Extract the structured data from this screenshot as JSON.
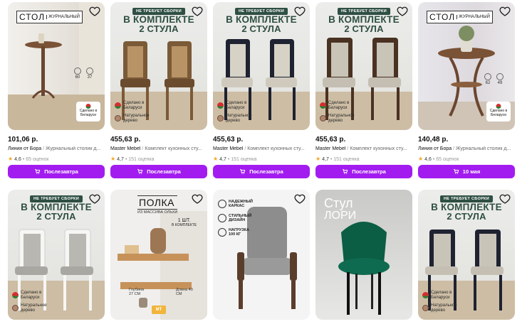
{
  "cards": [
    {
      "thumb_text": {
        "stol_big": "СТОЛ",
        "stol_small": "ЖУРНАЛЬНЫЙ",
        "dim1": "60",
        "dim2": "37",
        "badge": "Сделано в Беларуси"
      },
      "price": "101,06 р.",
      "seller": "Линия от Бора",
      "title": "Журнальный столик д...",
      "rating": "4,6",
      "reviews": "65 оценок",
      "button": "Послезавтра"
    },
    {
      "thumb_text": {
        "top": "НЕ ТРЕБУЕТ СБОРКИ",
        "line1": "В КОМПЛЕКТЕ",
        "line2": "2 СТУЛА",
        "made": "Сделано в Беларуси",
        "wood": "Натуральное дерево"
      },
      "price": "455,63 р.",
      "seller": "Master Mebel",
      "title": "Комплект кухонных сту...",
      "rating": "4,7",
      "reviews": "151 оценка",
      "button": "Послезавтра"
    },
    {
      "thumb_text": {
        "top": "НЕ ТРЕБУЕТ СБОРКИ",
        "line1": "В КОМПЛЕКТЕ",
        "line2": "2 СТУЛА",
        "made": "Сделано в Беларуси",
        "wood": "Натуральное дерево"
      },
      "price": "455,63 р.",
      "seller": "Master Mebel",
      "title": "Комплект кухонных сту...",
      "rating": "4,7",
      "reviews": "151 оценка",
      "button": "Послезавтра"
    },
    {
      "thumb_text": {
        "top": "НЕ ТРЕБУЕТ СБОРКИ",
        "line1": "В КОМПЛЕКТЕ",
        "line2": "2 СТУЛА",
        "made": "Сделано в Беларуси",
        "wood": "Натуральное дерево"
      },
      "price": "455,63 р.",
      "seller": "Master Mebel",
      "title": "Комплект кухонных сту...",
      "rating": "4,7",
      "reviews": "151 оценка",
      "button": "Послезавтра"
    },
    {
      "thumb_text": {
        "stol_big": "СТОЛ",
        "stol_small": "ЖУРНАЛЬНЫЙ",
        "dim1": "62",
        "dim2": "49",
        "badge": "Сделано в Беларуси"
      },
      "price": "140,48 р.",
      "seller": "Линия от Бора",
      "title": "Журнальный столик д...",
      "rating": "4,6",
      "reviews": "65 оценок",
      "button": "10 мая"
    }
  ],
  "row2": [
    {
      "top": "НЕ ТРЕБУЕТ СБОРКИ",
      "line1": "В КОМПЛЕКТЕ",
      "line2": "2 СТУЛА",
      "made": "Сделано в Беларуси",
      "wood": "Натуральное дерево"
    },
    {
      "big": "ПОЛКА",
      "small": "ИЗ МАССИВА ОЛЬХИ",
      "qty": "1 ШТ.",
      "qty_sub": "В КОМПЛЕКТЕ",
      "depth": "Глубина 27 СМ",
      "length": "Длина 40 СМ",
      "brand": "МТ"
    },
    {
      "f1": "НАДЕЖНЫЙ КАРКАС",
      "f2": "СТИЛЬНЫЙ ДИЗАЙН",
      "f3": "НАГРУЗКА 100 КГ"
    },
    {
      "line1": "Стул",
      "line2": "ЛОРИ"
    },
    {
      "top": "НЕ ТРЕБУЕТ СБОРКИ",
      "line1": "В КОМПЛЕКТЕ",
      "line2": "2 СТУЛА",
      "made": "Сделано в Беларуси",
      "wood": "Натуральное дерево"
    }
  ],
  "colors": {
    "accent": "#a21cf0",
    "banner": "#2f4f43",
    "star": "#f5a623"
  },
  "icons": {
    "favorite": "heart-outline-icon",
    "cart": "cart-icon",
    "star": "star-icon"
  }
}
